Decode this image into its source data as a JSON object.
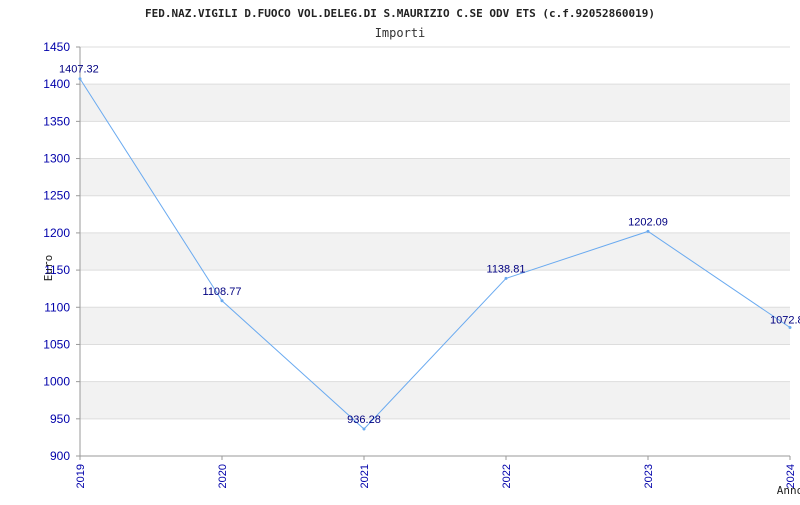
{
  "chart_data": {
    "type": "line",
    "title": "FED.NAZ.VIGILI D.FUOCO VOL.DELEG.DI S.MAURIZIO C.SE ODV ETS (c.f.92052860019)",
    "subtitle": "Importi",
    "xlabel": "Anno",
    "ylabel": "Euro",
    "x": [
      "2019",
      "2020",
      "2021",
      "2022",
      "2023",
      "2024"
    ],
    "series": [
      {
        "values": [
          1407.32,
          1108.77,
          936.28,
          1138.81,
          1202.09,
          1072.8
        ]
      }
    ],
    "data_labels": [
      "1407.32",
      "1108.77",
      "936.28",
      "1138.81",
      "1202.09",
      "1072.8"
    ],
    "y_ticks": [
      "900",
      "950",
      "1000",
      "1050",
      "1100",
      "1150",
      "1200",
      "1250",
      "1300",
      "1350",
      "1400",
      "1450"
    ],
    "ylim": [
      900,
      1450
    ],
    "grid": true,
    "colors": {
      "line": "#6aaaf0",
      "band": "#f2f2f2",
      "grid": "#dddddd",
      "tick_text": "#0000aa",
      "label_text": "#000080"
    }
  }
}
